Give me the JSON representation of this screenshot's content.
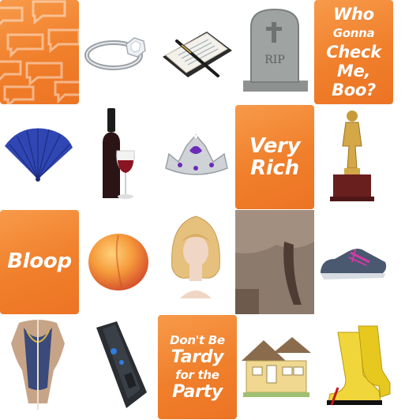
{
  "tiles": [
    {
      "name": "pattern-tile",
      "kind": "pattern"
    },
    {
      "name": "diamond-ring-image",
      "kind": "image"
    },
    {
      "name": "checkbook-pen-image",
      "kind": "image"
    },
    {
      "name": "rip-tombstone-image",
      "kind": "image",
      "engraving": "RIP"
    },
    {
      "name": "phrase-who-gonna-check-me-boo",
      "kind": "phrase",
      "lines": [
        "Who",
        "Gonna",
        "Check",
        "Me,",
        "Boo?"
      ]
    },
    {
      "name": "blue-fan-image",
      "kind": "image"
    },
    {
      "name": "red-wine-image",
      "kind": "image"
    },
    {
      "name": "tiara-image",
      "kind": "image"
    },
    {
      "name": "phrase-very-rich",
      "kind": "phrase",
      "lines": [
        "Very",
        "Rich"
      ]
    },
    {
      "name": "trophy-statue-image",
      "kind": "image"
    },
    {
      "name": "phrase-bloop",
      "kind": "phrase",
      "lines": [
        "Bloop"
      ]
    },
    {
      "name": "peach-image",
      "kind": "image"
    },
    {
      "name": "blonde-wig-image",
      "kind": "image"
    },
    {
      "name": "donkey-tail-image",
      "kind": "image"
    },
    {
      "name": "sneaker-image",
      "kind": "image"
    },
    {
      "name": "dress-form-image",
      "kind": "image"
    },
    {
      "name": "taser-image",
      "kind": "image"
    },
    {
      "name": "phrase-dont-be-tardy",
      "kind": "phrase",
      "lines": [
        "Don't Be",
        "Tardy",
        "for the",
        "Party"
      ]
    },
    {
      "name": "house-image",
      "kind": "image"
    },
    {
      "name": "yellow-heels-image",
      "kind": "image"
    }
  ],
  "colors": {
    "orange_tile": "#f07f2b",
    "text_on_orange": "#ffffff"
  }
}
